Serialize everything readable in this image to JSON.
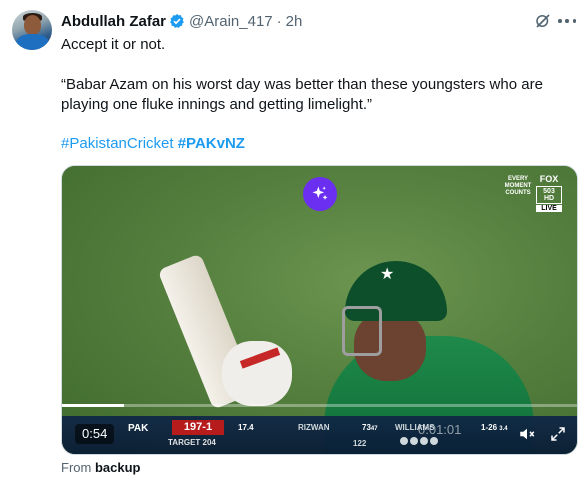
{
  "tweet": {
    "author_name": "Abdullah Zafar",
    "handle": "@Arain_417",
    "separator": "·",
    "time": "2h",
    "line1": "Accept it or not.",
    "quote": "“Babar Azam on his worst day was better than these youngsters who are playing one fluke innings and getting limelight.”",
    "hashtag1": "#PakistanCricket",
    "hashtag2": "#PAKvNZ"
  },
  "video": {
    "time_display": "0:54",
    "progress": 0.12,
    "overlay_logo_text": "EVERY MOMENT COUNTS",
    "broadcaster": "FOX",
    "broadcaster_sub": "503 HD",
    "broadcaster_live": "LIVE",
    "scorebar": {
      "team": "PAK",
      "score": "197-1",
      "target": "TARGET 204",
      "overs": "17.4",
      "batter1": "RIZWAN",
      "batter1_score": "73",
      "batter1_balls": "47",
      "batter2_score": "122",
      "bowler": "WILLIAMS",
      "bowler_figures": "1-26",
      "bowler_overs": "3.4",
      "ghost_timer": "0:01:01"
    }
  },
  "source": {
    "prefix": "From",
    "name": "backup"
  },
  "colors": {
    "link": "#1d9bf0",
    "secondary_text": "#536471",
    "grok_purple": "#6b2ff2",
    "score_red": "#b71c1c"
  },
  "icons": [
    "verified-badge-icon",
    "grok-icon",
    "more-icon",
    "sparkle-icon",
    "volume-icon",
    "expand-icon"
  ]
}
